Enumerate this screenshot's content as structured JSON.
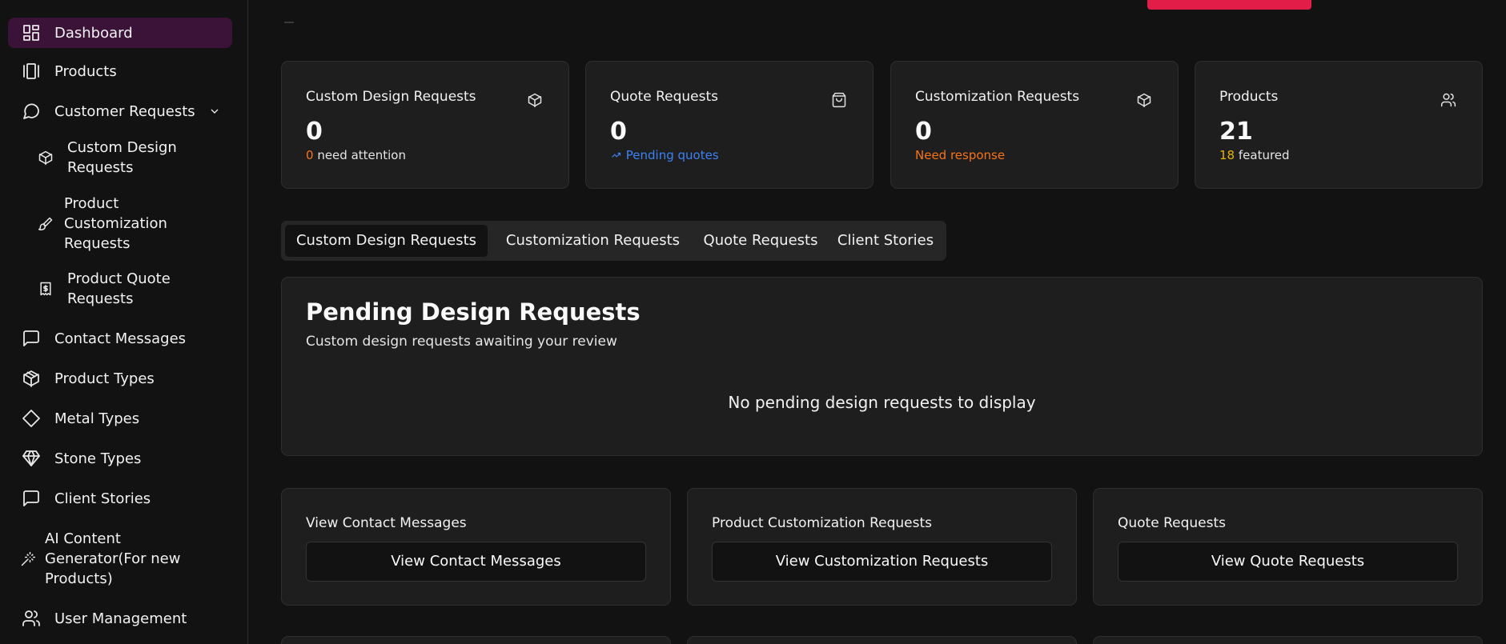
{
  "sidebar": {
    "items": [
      {
        "label": "Dashboard",
        "icon": "dashboard-icon",
        "active": true
      },
      {
        "label": "Products",
        "icon": "products-icon"
      },
      {
        "label": "Customer Requests",
        "icon": "message-circle-icon"
      },
      {
        "label": "Contact Messages",
        "icon": "message-square-icon"
      },
      {
        "label": "Product Types",
        "icon": "package-icon"
      },
      {
        "label": "Metal Types",
        "icon": "diamond-icon"
      },
      {
        "label": "Stone Types",
        "icon": "gem-icon"
      },
      {
        "label": "Client Stories",
        "icon": "message-square-icon"
      },
      {
        "label": "User Management",
        "icon": "users-icon"
      }
    ],
    "sub_items": [
      {
        "line1": "Custom Design",
        "line2": "Requests",
        "icon": "package-icon"
      },
      {
        "line1": "Product",
        "line2": "Customization",
        "line3": "Requests",
        "icon": "brush-icon"
      },
      {
        "line1": "Product Quote",
        "line2": "Requests",
        "icon": "receipt-dollar-icon"
      }
    ],
    "ai_item": {
      "line1": "AI Content",
      "line2": "Generator(For new",
      "line3": "Products)",
      "icon": "magic-wand-icon"
    }
  },
  "stats": [
    {
      "title": "Custom Design Requests",
      "value": "0",
      "sub_highlight": "0",
      "sub_text": " need attention",
      "icon": "package-icon"
    },
    {
      "title": "Quote Requests",
      "value": "0",
      "sub_text": "Pending quotes",
      "icon": "shopping-bag-icon"
    },
    {
      "title": "Customization Requests",
      "value": "0",
      "sub_text": "Need response",
      "icon": "package-icon"
    },
    {
      "title": "Products",
      "value": "21",
      "sub_highlight": "18",
      "sub_text": " featured",
      "icon": "users-icon"
    }
  ],
  "tabs": [
    "Custom Design Requests",
    "Customization Requests",
    "Quote Requests",
    "Client Stories"
  ],
  "panel": {
    "title": "Pending Design Requests",
    "subtitle": "Custom design requests awaiting your review",
    "empty": "No pending design requests to display"
  },
  "actions": [
    {
      "title": "View Contact Messages",
      "button": "View Contact Messages"
    },
    {
      "title": "Product Customization Requests",
      "button": "View Customization Requests"
    },
    {
      "title": "Quote Requests",
      "button": "View Quote Requests"
    }
  ],
  "colors": {
    "accent": "#e11d48",
    "active_nav": "#3b1238",
    "warning": "#f97316",
    "info": "#3b82f6",
    "featured": "#eab308"
  }
}
